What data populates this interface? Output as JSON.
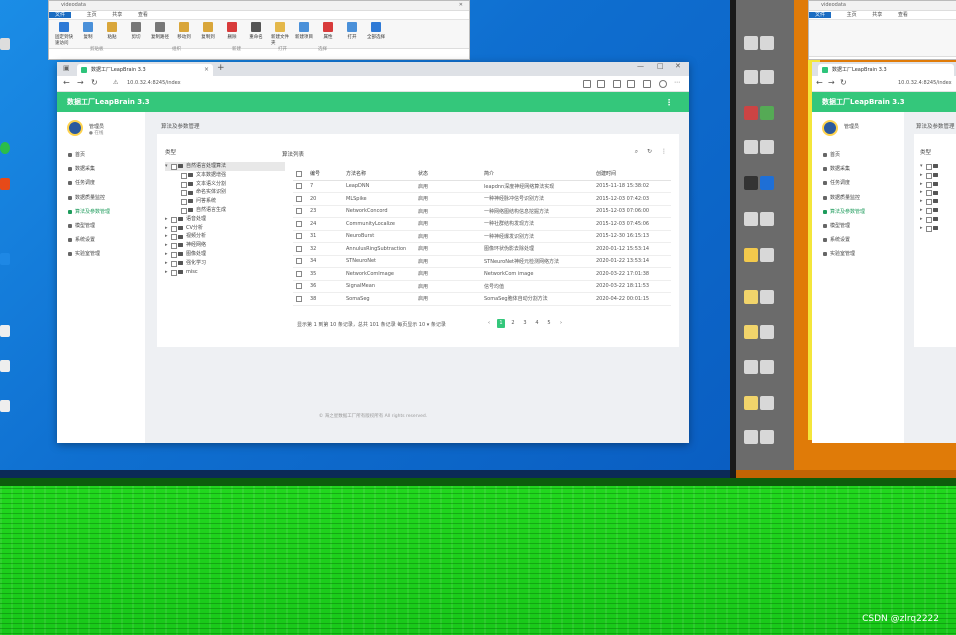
{
  "explorer_left": {
    "title": "videodata",
    "tabs": [
      "文件",
      "主页",
      "共享",
      "查看"
    ],
    "ribbon": [
      {
        "label": "固定到快速访问",
        "color": "#2f7ad6"
      },
      {
        "label": "复制",
        "color": "#4a90d9"
      },
      {
        "label": "粘贴",
        "color": "#d9a63a"
      },
      {
        "label": "剪切",
        "color": "#777777"
      },
      {
        "label": "复制路径",
        "color": "#777777"
      },
      {
        "label": "移动到",
        "color": "#d9a63a"
      },
      {
        "label": "复制到",
        "color": "#d9a63a"
      },
      {
        "label": "删除",
        "color": "#d83b3b"
      },
      {
        "label": "重命名",
        "color": "#555555"
      },
      {
        "label": "新建文件夹",
        "color": "#e4b84a"
      },
      {
        "label": "新建项目",
        "color": "#4a90d9"
      },
      {
        "label": "属性",
        "color": "#d83b3b"
      },
      {
        "label": "打开",
        "color": "#4a90d9"
      },
      {
        "label": "全部选择",
        "color": "#2f7ad6"
      }
    ],
    "groups": [
      "剪贴板",
      "组织",
      "新建",
      "打开",
      "选择"
    ]
  },
  "explorer_right": {
    "title": "videodata",
    "tabs": [
      "文件",
      "主页",
      "共享",
      "查看"
    ]
  },
  "browser": {
    "tab_title": "数据工厂LeapBrain 3.3",
    "url": "10.0.32.4:8245/index",
    "window_controls": [
      "—",
      "□",
      "✕"
    ]
  },
  "app": {
    "title": "数据工厂LeapBrain 3.3",
    "user_name": "管理员",
    "user_status": "● 在线",
    "menu": [
      {
        "label": "首页",
        "active": false
      },
      {
        "label": "数据采集",
        "active": false
      },
      {
        "label": "任务调度",
        "active": false
      },
      {
        "label": "数据质量监控",
        "active": false
      },
      {
        "label": "算法及参数管理",
        "active": true
      },
      {
        "label": "模型管理",
        "active": false
      },
      {
        "label": "系统设置",
        "active": false
      },
      {
        "label": "实验室管理",
        "active": false
      }
    ],
    "breadcrumb": "算法及参数管理",
    "tree_title": "类型",
    "tree": [
      {
        "label": "自然语言处理算法",
        "level": 0,
        "expanded": true,
        "selected": true
      },
      {
        "label": "文本数据增强",
        "level": 1
      },
      {
        "label": "文本语义分割",
        "level": 1
      },
      {
        "label": "命名实体识别",
        "level": 1
      },
      {
        "label": "问答系统",
        "level": 1
      },
      {
        "label": "自然语言生成",
        "level": 1
      },
      {
        "label": "语音处理",
        "level": 0,
        "expanded": false
      },
      {
        "label": "CV分析",
        "level": 0,
        "expanded": false
      },
      {
        "label": "视频分析",
        "level": 0,
        "expanded": false
      },
      {
        "label": "神经网络",
        "level": 0,
        "expanded": false
      },
      {
        "label": "图像处理",
        "level": 0,
        "expanded": false
      },
      {
        "label": "强化学习",
        "level": 0,
        "expanded": false
      },
      {
        "label": "misc",
        "level": 0,
        "expanded": false
      }
    ],
    "list_title": "算法列表",
    "columns": [
      "编号",
      "方法名称",
      "状态",
      "简介",
      "创建时间"
    ],
    "rows": [
      {
        "id": "7",
        "name": "LeapDNN",
        "status": "启用",
        "desc": "leapdnn深度神经网络算法实现",
        "time": "2015-11-18 15:38:02"
      },
      {
        "id": "20",
        "name": "MLSpike",
        "status": "启用",
        "desc": "一种神经脉冲信号识别方法",
        "time": "2015-12-03 07:42:03"
      },
      {
        "id": "23",
        "name": "NetworkConcord",
        "status": "启用",
        "desc": "一种网络图结构信息挖掘方法",
        "time": "2015-12-03 07:06:00"
      },
      {
        "id": "24",
        "name": "CommunityLocalize",
        "status": "启用",
        "desc": "一种社群结构发现方法",
        "time": "2015-12-03 07:45:06"
      },
      {
        "id": "31",
        "name": "NeuroBurst",
        "status": "启用",
        "desc": "一种神经爆发识别方法",
        "time": "2015-12-30 16:15:13"
      },
      {
        "id": "32",
        "name": "AnnulusRingSubtraction",
        "status": "启用",
        "desc": "图像环状伪影去除处理",
        "time": "2020-01-12 15:53:14"
      },
      {
        "id": "34",
        "name": "STNeuroNet",
        "status": "启用",
        "desc": "STNeuroNet神经元检测网络方法",
        "time": "2020-01-22 13:53:14"
      },
      {
        "id": "35",
        "name": "NetworkComImage",
        "status": "启用",
        "desc": "NetworkCom image",
        "time": "2020-03-22 17:01:38"
      },
      {
        "id": "36",
        "name": "SignalMean",
        "status": "启用",
        "desc": "信号均值",
        "time": "2020-03-22 18:11:53"
      },
      {
        "id": "38",
        "name": "SomaSeg",
        "status": "启用",
        "desc": "SomaSeg胞体自动分割方法",
        "time": "2020-04-22 00:01:15"
      }
    ],
    "page_info": "显示第 1 到第 10 条记录，总共 101 条记录 每页显示 10 ▾ 条记录",
    "pager": [
      "‹",
      "1",
      "2",
      "3",
      "4",
      "5",
      "›"
    ],
    "current_page": "1",
    "footer": "© 海之星数据工厂所有版权所有 All rights reserved."
  },
  "right_browser": {
    "tab_title": "数据工厂LeapBrain 3.3",
    "url": "10.0.32.4:8245/index",
    "app_title": "数据工厂LeapBrain 3.3",
    "user_name": "管理员",
    "breadcrumb": "算法及参数管理",
    "tree_title": "类型",
    "menu": [
      "首页",
      "数据采集",
      "任务调度",
      "数据质量监控",
      "算法及参数管理",
      "模型管理",
      "系统设置",
      "实验室管理"
    ]
  },
  "watermark": "CSDN @zlrq2222"
}
